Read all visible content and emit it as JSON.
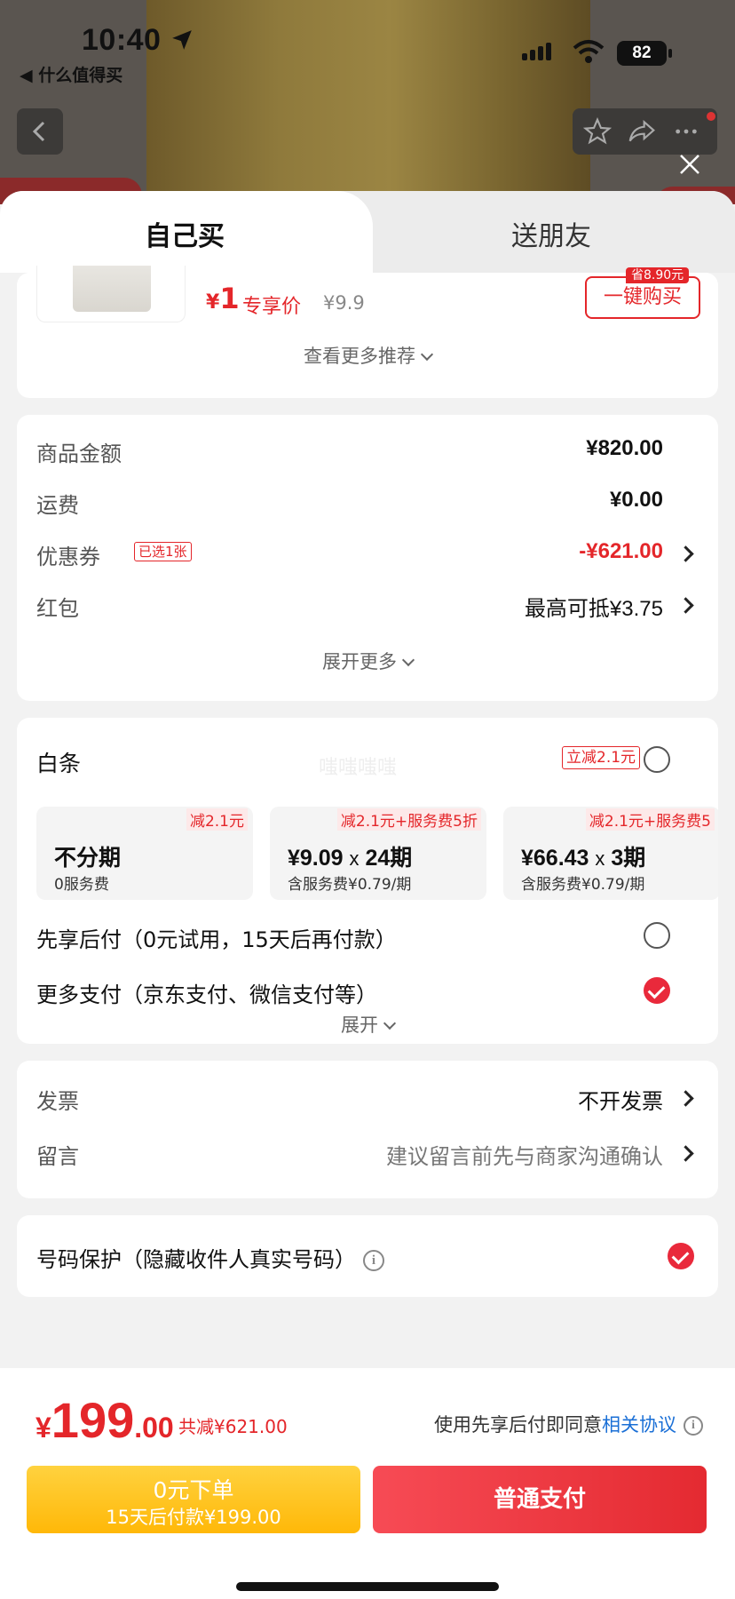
{
  "status_bar": {
    "time": "10:40",
    "back_app": "◀ 什么值得买",
    "battery": "82"
  },
  "tabs": {
    "self_buy": "自己买",
    "gift": "送朋友"
  },
  "recommend": {
    "price_symbol": "¥",
    "price": "1",
    "exclusive_label": "专享价",
    "original_price": "¥9.9",
    "save_tag": "省8.90元",
    "buy_button": "一键购买",
    "see_more": "查看更多推荐"
  },
  "summary": {
    "goods_amount_label": "商品金额",
    "goods_amount": "¥820.00",
    "shipping_label": "运费",
    "shipping": "¥0.00",
    "coupon_label": "优惠券",
    "coupon_badge": "已选1张",
    "coupon_value": "-¥621.00",
    "redpacket_label": "红包",
    "redpacket_value": "最高可抵¥3.75",
    "expand_more": "展开更多"
  },
  "payment": {
    "baitiao_label": "白条",
    "watermark": "嗤嗤嗤嗤",
    "baitiao_discount": "立减2.1元",
    "plans": [
      {
        "tag": "减2.1元",
        "main": "不分期",
        "times": "",
        "sub": "0服务费"
      },
      {
        "tag": "减2.1元+服务费5折",
        "main": "¥9.09",
        "times": "24期",
        "sub": "含服务费¥0.79/期"
      },
      {
        "tag": "减2.1元+服务费5",
        "main": "¥66.43",
        "times": "3期",
        "sub": "含服务费¥0.79/期"
      }
    ],
    "times_symbol": "x",
    "pay_later": "先享后付（0元试用，15天后再付款）",
    "more_pay": "更多支付（京东支付、微信支付等）",
    "expand": "展开"
  },
  "invoice": {
    "invoice_label": "发票",
    "invoice_value": "不开发票",
    "message_label": "留言",
    "message_placeholder": "建议留言前先与商家沟通确认"
  },
  "privacy": {
    "label": "号码保护（隐藏收件人真实号码）",
    "info_icon": "i"
  },
  "bottom": {
    "total_symbol": "¥",
    "total_int": "199",
    "total_dec": ".00",
    "total_reduce": "共减¥621.00",
    "agree_text": "使用先享后付即同意",
    "agree_link": "相关协议",
    "btn_zero_line1": "0元下单",
    "btn_zero_line2": "15天后付款¥199.00",
    "btn_normal": "普通支付"
  },
  "colors": {
    "accent_red": "#e4262a",
    "link_blue": "#1a6fd6",
    "yellow": "#ffc21f"
  }
}
